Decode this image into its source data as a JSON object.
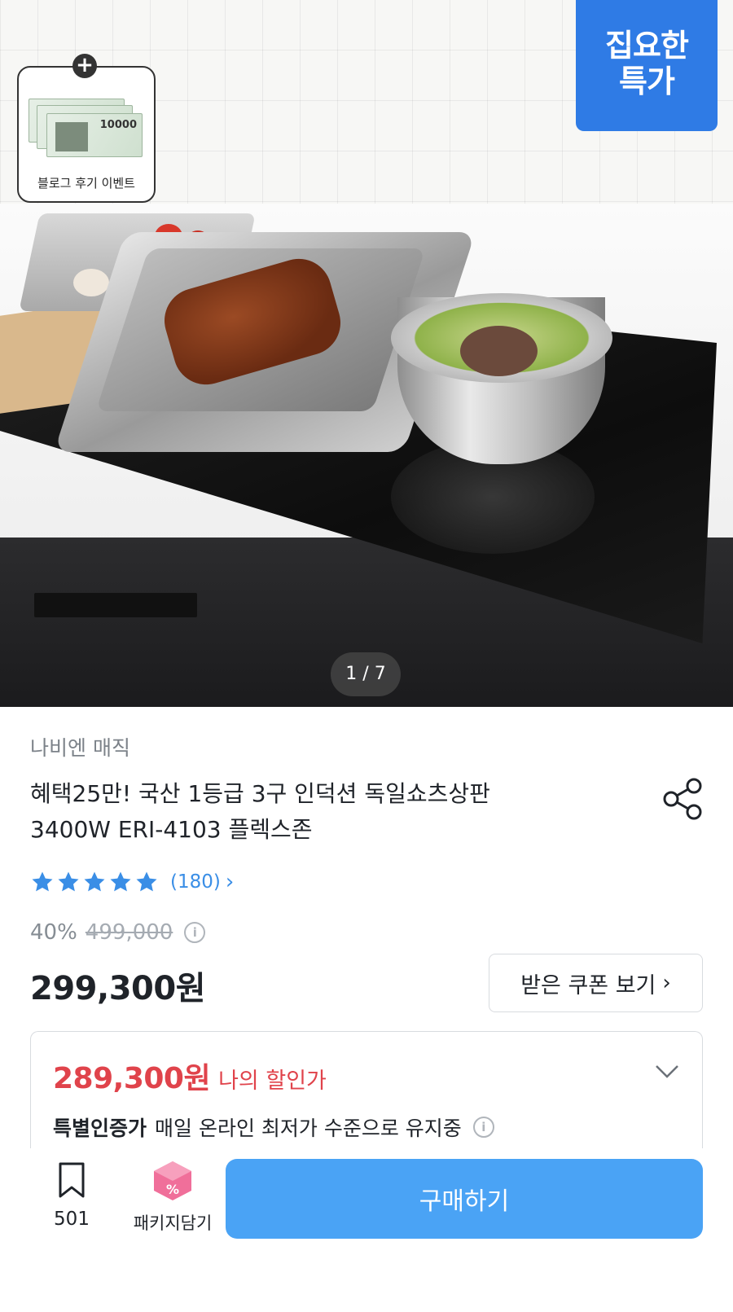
{
  "hero": {
    "event_label": "블로그 후기 이벤트",
    "voucher_amount": "10000",
    "badge_line1": "집요한",
    "badge_line2": "특가",
    "page_indicator": "1 / 7"
  },
  "product": {
    "brand": "나비엔 매직",
    "title_line1": "혜택25만! 국산 1등급 3구 인덕션 독일쇼츠상판",
    "title_line2": "3400W ERI-4103 플렉스존",
    "rating_stars": 5,
    "review_count": "(180)",
    "discount_rate": "40%",
    "original_price": "499,000",
    "price": "299,300원",
    "coupon_button": "받은 쿠폰 보기"
  },
  "my_discount": {
    "price": "289,300원",
    "label": "나의 할인가",
    "special_strong": "특별인증가",
    "special_text": "매일 온라인 최저가 수준으로 유지중"
  },
  "bottom_bar": {
    "bookmark_count": "501",
    "package_label": "패키지담기",
    "buy_label": "구매하기"
  },
  "colors": {
    "accent_blue": "#4aa3f5",
    "badge_blue": "#2f7be5",
    "discount_red": "#e0434b",
    "star_blue": "#3a8ee6",
    "package_pink": "#f06f9a"
  },
  "icons": {
    "share": "share-icon",
    "star": "star-icon",
    "info": "info-icon",
    "chevron": "chevron-down-icon",
    "bookmark": "bookmark-icon",
    "package": "package-box-icon"
  }
}
